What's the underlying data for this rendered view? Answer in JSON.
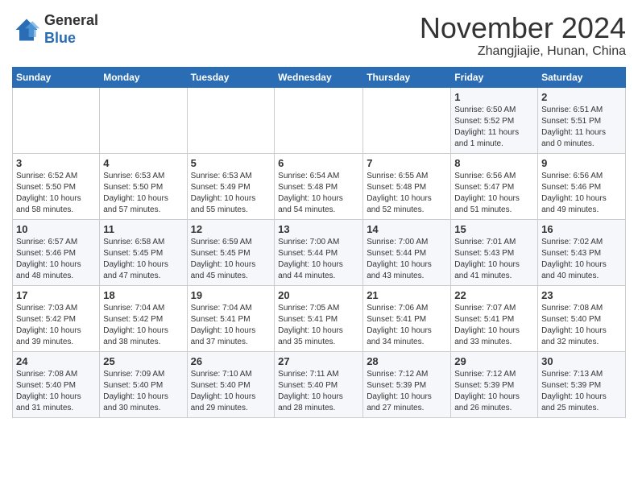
{
  "header": {
    "logo": {
      "general": "General",
      "blue": "Blue"
    },
    "month": "November 2024",
    "location": "Zhangjiajie, Hunan, China"
  },
  "weekdays": [
    "Sunday",
    "Monday",
    "Tuesday",
    "Wednesday",
    "Thursday",
    "Friday",
    "Saturday"
  ],
  "weeks": [
    [
      {
        "day": "",
        "info": ""
      },
      {
        "day": "",
        "info": ""
      },
      {
        "day": "",
        "info": ""
      },
      {
        "day": "",
        "info": ""
      },
      {
        "day": "",
        "info": ""
      },
      {
        "day": "1",
        "info": "Sunrise: 6:50 AM\nSunset: 5:52 PM\nDaylight: 11 hours\nand 1 minute."
      },
      {
        "day": "2",
        "info": "Sunrise: 6:51 AM\nSunset: 5:51 PM\nDaylight: 11 hours\nand 0 minutes."
      }
    ],
    [
      {
        "day": "3",
        "info": "Sunrise: 6:52 AM\nSunset: 5:50 PM\nDaylight: 10 hours\nand 58 minutes."
      },
      {
        "day": "4",
        "info": "Sunrise: 6:53 AM\nSunset: 5:50 PM\nDaylight: 10 hours\nand 57 minutes."
      },
      {
        "day": "5",
        "info": "Sunrise: 6:53 AM\nSunset: 5:49 PM\nDaylight: 10 hours\nand 55 minutes."
      },
      {
        "day": "6",
        "info": "Sunrise: 6:54 AM\nSunset: 5:48 PM\nDaylight: 10 hours\nand 54 minutes."
      },
      {
        "day": "7",
        "info": "Sunrise: 6:55 AM\nSunset: 5:48 PM\nDaylight: 10 hours\nand 52 minutes."
      },
      {
        "day": "8",
        "info": "Sunrise: 6:56 AM\nSunset: 5:47 PM\nDaylight: 10 hours\nand 51 minutes."
      },
      {
        "day": "9",
        "info": "Sunrise: 6:56 AM\nSunset: 5:46 PM\nDaylight: 10 hours\nand 49 minutes."
      }
    ],
    [
      {
        "day": "10",
        "info": "Sunrise: 6:57 AM\nSunset: 5:46 PM\nDaylight: 10 hours\nand 48 minutes."
      },
      {
        "day": "11",
        "info": "Sunrise: 6:58 AM\nSunset: 5:45 PM\nDaylight: 10 hours\nand 47 minutes."
      },
      {
        "day": "12",
        "info": "Sunrise: 6:59 AM\nSunset: 5:45 PM\nDaylight: 10 hours\nand 45 minutes."
      },
      {
        "day": "13",
        "info": "Sunrise: 7:00 AM\nSunset: 5:44 PM\nDaylight: 10 hours\nand 44 minutes."
      },
      {
        "day": "14",
        "info": "Sunrise: 7:00 AM\nSunset: 5:44 PM\nDaylight: 10 hours\nand 43 minutes."
      },
      {
        "day": "15",
        "info": "Sunrise: 7:01 AM\nSunset: 5:43 PM\nDaylight: 10 hours\nand 41 minutes."
      },
      {
        "day": "16",
        "info": "Sunrise: 7:02 AM\nSunset: 5:43 PM\nDaylight: 10 hours\nand 40 minutes."
      }
    ],
    [
      {
        "day": "17",
        "info": "Sunrise: 7:03 AM\nSunset: 5:42 PM\nDaylight: 10 hours\nand 39 minutes."
      },
      {
        "day": "18",
        "info": "Sunrise: 7:04 AM\nSunset: 5:42 PM\nDaylight: 10 hours\nand 38 minutes."
      },
      {
        "day": "19",
        "info": "Sunrise: 7:04 AM\nSunset: 5:41 PM\nDaylight: 10 hours\nand 37 minutes."
      },
      {
        "day": "20",
        "info": "Sunrise: 7:05 AM\nSunset: 5:41 PM\nDaylight: 10 hours\nand 35 minutes."
      },
      {
        "day": "21",
        "info": "Sunrise: 7:06 AM\nSunset: 5:41 PM\nDaylight: 10 hours\nand 34 minutes."
      },
      {
        "day": "22",
        "info": "Sunrise: 7:07 AM\nSunset: 5:41 PM\nDaylight: 10 hours\nand 33 minutes."
      },
      {
        "day": "23",
        "info": "Sunrise: 7:08 AM\nSunset: 5:40 PM\nDaylight: 10 hours\nand 32 minutes."
      }
    ],
    [
      {
        "day": "24",
        "info": "Sunrise: 7:08 AM\nSunset: 5:40 PM\nDaylight: 10 hours\nand 31 minutes."
      },
      {
        "day": "25",
        "info": "Sunrise: 7:09 AM\nSunset: 5:40 PM\nDaylight: 10 hours\nand 30 minutes."
      },
      {
        "day": "26",
        "info": "Sunrise: 7:10 AM\nSunset: 5:40 PM\nDaylight: 10 hours\nand 29 minutes."
      },
      {
        "day": "27",
        "info": "Sunrise: 7:11 AM\nSunset: 5:40 PM\nDaylight: 10 hours\nand 28 minutes."
      },
      {
        "day": "28",
        "info": "Sunrise: 7:12 AM\nSunset: 5:39 PM\nDaylight: 10 hours\nand 27 minutes."
      },
      {
        "day": "29",
        "info": "Sunrise: 7:12 AM\nSunset: 5:39 PM\nDaylight: 10 hours\nand 26 minutes."
      },
      {
        "day": "30",
        "info": "Sunrise: 7:13 AM\nSunset: 5:39 PM\nDaylight: 10 hours\nand 25 minutes."
      }
    ]
  ]
}
